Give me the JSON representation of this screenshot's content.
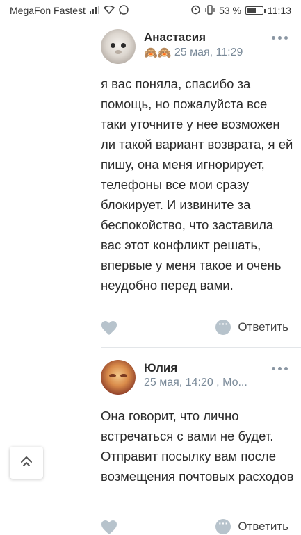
{
  "status_bar": {
    "carrier": "MegaFon Fastest",
    "battery": "53 %",
    "time": "11:13"
  },
  "comments": [
    {
      "author": "Анастасия",
      "emoji": "🙈🙈",
      "date": "25 мая, 11:29",
      "text": "я вас поняла, спасибо за помощь, но пожалуйста все таки уточните у нее возможен ли такой вариант возврата, я ей пишу, она меня игнорирует, телефоны все мои сразу блокирует. И извините за беспокойство, что заставила вас этот конфликт решать, впервые у меня такое и очень неудобно перед вами.",
      "reply_label": "Ответить"
    },
    {
      "author": "Юлия",
      "date": "25 мая, 14:20 , Мо...",
      "text": "Она говорит, что лично встречаться с вами не будет. Отправит посылку вам после возмещения почтовых расходов",
      "reply_label": "Ответить"
    }
  ],
  "colors": {
    "meta": "#7a8a99",
    "icon_grey": "#b7c3cc",
    "divider": "#e3e6e9"
  },
  "icons": [
    "signal-icon",
    "wifi-icon",
    "whatsapp-icon",
    "alarm-icon",
    "vibrate-icon",
    "battery-icon",
    "more-icon",
    "like-icon",
    "reply-icon",
    "scroll-up-icon"
  ]
}
